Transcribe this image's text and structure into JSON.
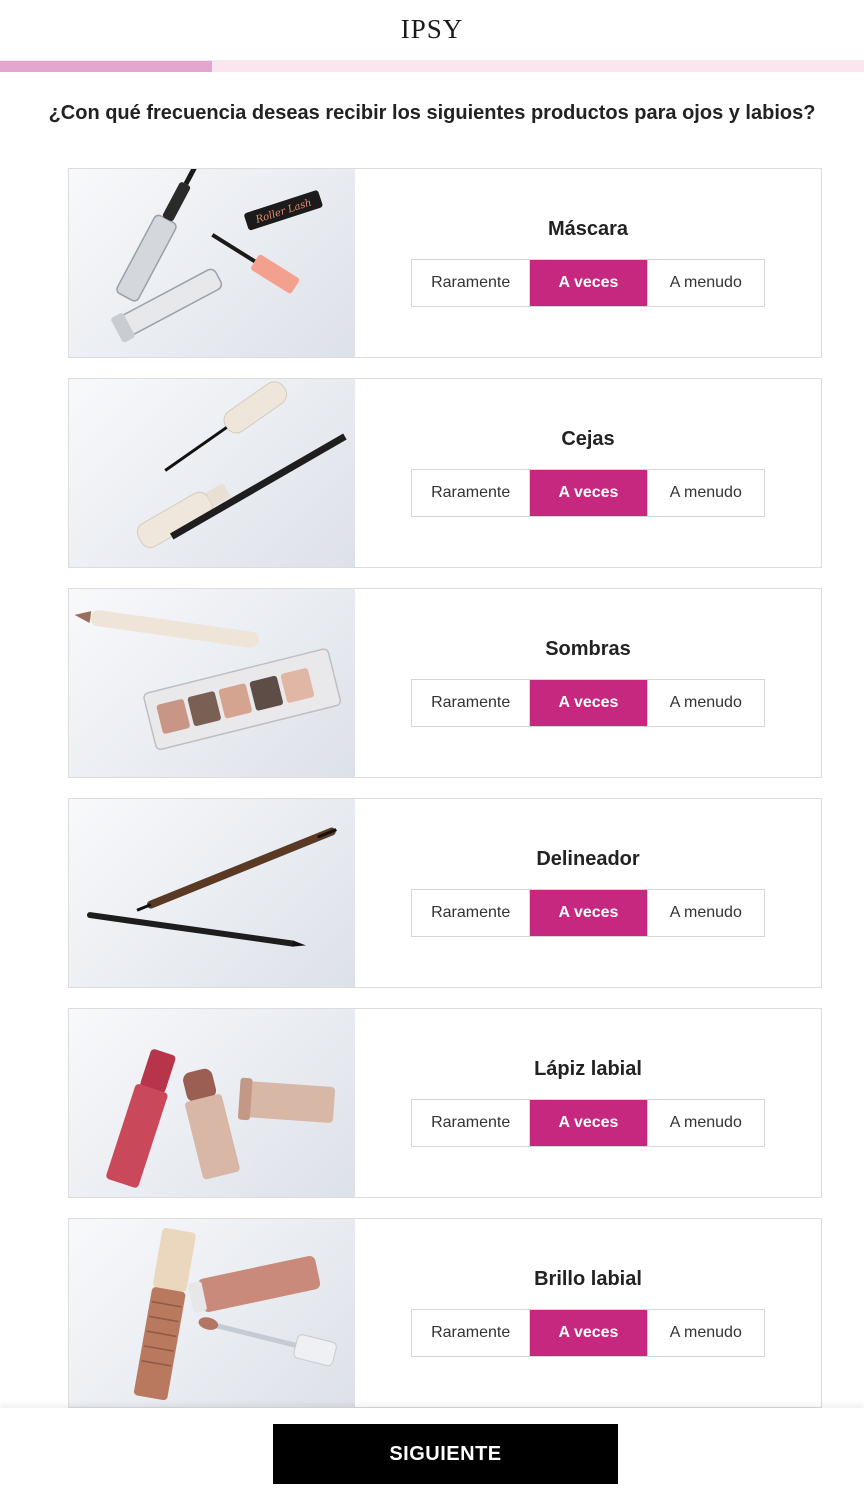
{
  "header": {
    "logo": "IPSY"
  },
  "progress": {
    "fraction": 0.245
  },
  "question": "¿Con qué frecuencia deseas recibir los siguientes productos para ojos y labios?",
  "options": [
    "Raramente",
    "A veces",
    "A menudo"
  ],
  "cards": [
    {
      "title": "Máscara",
      "image": "mascara-products",
      "selected": "A veces"
    },
    {
      "title": "Cejas",
      "image": "brow-products",
      "selected": "A veces"
    },
    {
      "title": "Sombras",
      "image": "eyeshadow-products",
      "selected": "A veces"
    },
    {
      "title": "Delineador",
      "image": "eyeliner-products",
      "selected": "A veces"
    },
    {
      "title": "Lápiz labial",
      "image": "lipstick-products",
      "selected": "A veces"
    },
    {
      "title": "Brillo labial",
      "image": "lipgloss-products",
      "selected": "A veces"
    }
  ],
  "colors": {
    "accent": "#c5287e",
    "progress_fill": "#e3a6cf",
    "progress_track": "#fbe6ef",
    "button": "#000000"
  },
  "footer": {
    "next_label": "SIGUIENTE"
  }
}
